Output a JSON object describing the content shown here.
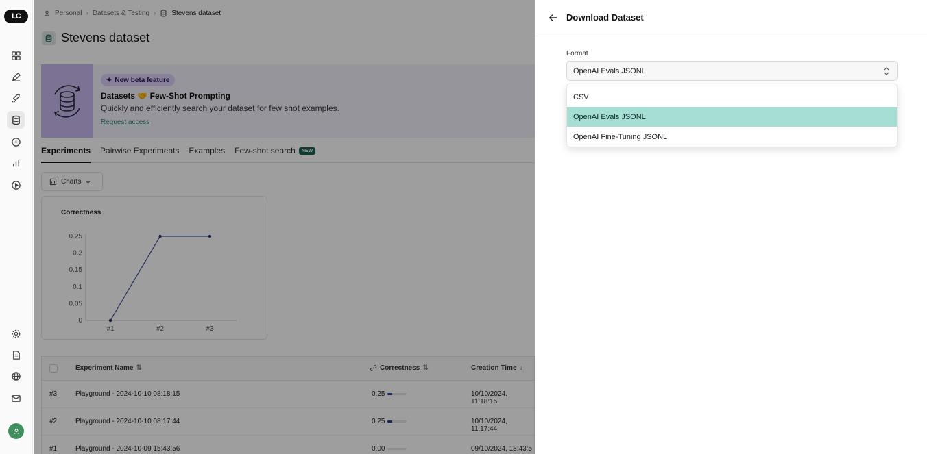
{
  "sidebar": {
    "logo": "LC",
    "icons": [
      "grid-icon",
      "pen-icon",
      "rocket-icon",
      "database-icon",
      "chat-icon",
      "chart-icon",
      "play-icon",
      "settings-icon",
      "document-icon",
      "globe-icon",
      "mail-icon"
    ]
  },
  "breadcrumb": {
    "personal": "Personal",
    "datasets": "Datasets & Testing",
    "current": "Stevens dataset"
  },
  "page": {
    "title": "Stevens dataset"
  },
  "banner": {
    "badge": "New beta feature",
    "title": "Datasets 🤝 Few-Shot Prompting",
    "description": "Quickly and efficiently search your dataset for few shot examples.",
    "link": "Request access"
  },
  "tabs": [
    {
      "label": "Experiments",
      "active": true
    },
    {
      "label": "Pairwise Experiments",
      "active": false
    },
    {
      "label": "Examples",
      "active": false
    },
    {
      "label": "Few-shot search",
      "active": false,
      "badge": "NEW"
    }
  ],
  "charts_button": "Charts",
  "chart_data": {
    "type": "line",
    "title": "Correctness",
    "categories": [
      "#1",
      "#2",
      "#3"
    ],
    "values": [
      0,
      0.25,
      0.25
    ],
    "yticks": [
      "0",
      "0.05",
      "0.1",
      "0.15",
      "0.2",
      "0.25"
    ],
    "ylim": [
      0,
      0.25
    ],
    "grid": false,
    "color": "#4a5aa0"
  },
  "table": {
    "headers": {
      "name": "Experiment Name",
      "correctness": "Correctness",
      "creation_time": "Creation Time"
    },
    "rows": [
      {
        "id": "#3",
        "name": "Playground - 2024-10-10 08:18:15",
        "correctness": "0.25",
        "score": 0.25,
        "time": "10/10/2024, 11:18:15"
      },
      {
        "id": "#2",
        "name": "Playground - 2024-10-10 08:17:44",
        "correctness": "0.25",
        "score": 0.25,
        "time": "10/10/2024, 11:17:44"
      },
      {
        "id": "#1",
        "name": "Playground - 2024-10-09 15:43:56",
        "correctness": "0.00",
        "score": 0,
        "time": "09/10/2024, 18:43:5"
      }
    ]
  },
  "drawer": {
    "title": "Download Dataset",
    "format_label": "Format",
    "selected_value": "OpenAI Evals JSONL",
    "options": [
      {
        "label": "CSV",
        "selected": false
      },
      {
        "label": "OpenAI Evals JSONL",
        "selected": true
      },
      {
        "label": "OpenAI Fine-Tuning JSONL",
        "selected": false
      }
    ]
  },
  "colors": {
    "accent": "#a7ded3",
    "badge_purple": "#dccff7",
    "new_badge": "#1f5f58",
    "link": "#2f8a7a"
  }
}
